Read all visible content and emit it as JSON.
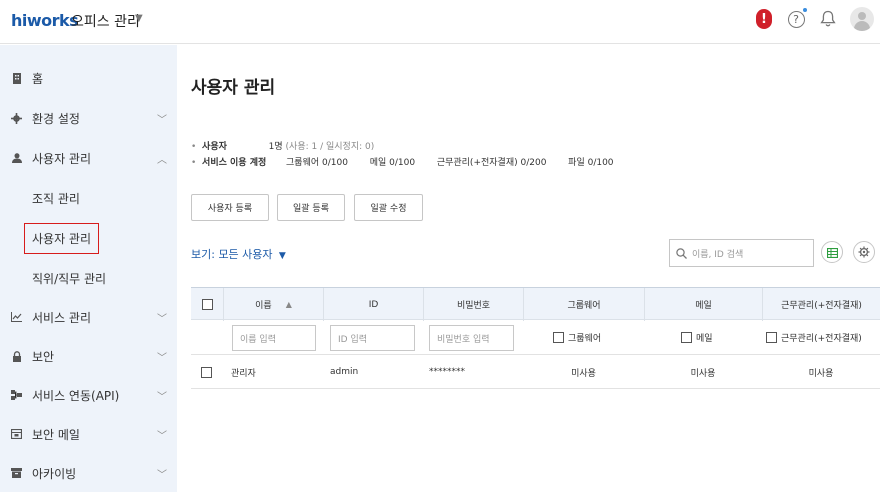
{
  "topbar": {
    "logo": "hiworks",
    "app_title": "오피스 관리",
    "icons": [
      "alert-icon",
      "help-icon",
      "bell-icon",
      "avatar"
    ]
  },
  "sidebar": {
    "items": [
      {
        "label": "홈",
        "icon": "building-icon"
      },
      {
        "label": "환경 설정",
        "icon": "gear-icon"
      },
      {
        "label": "사용자 관리",
        "icon": "person-icon"
      },
      {
        "label": "서비스 관리",
        "icon": "chart-icon"
      },
      {
        "label": "보안",
        "icon": "lock-icon"
      },
      {
        "label": "서비스 연동(API)",
        "icon": "link-icon"
      },
      {
        "label": "보안 메일",
        "icon": "mail-icon"
      },
      {
        "label": "아카이빙",
        "icon": "archive-icon"
      }
    ],
    "subitems": [
      {
        "label": "조직 관리"
      },
      {
        "label": "사용자 관리"
      },
      {
        "label": "직위/직무 관리"
      }
    ]
  },
  "main": {
    "title": "사용자 관리",
    "stats": {
      "users_label": "사용자",
      "users_value": "1명",
      "users_detail": "(사용: 1 / 일시정지: 0)",
      "accounts_label": "서비스 이용 계정",
      "groupware": "그룹웨어  0/100",
      "mail": "메일  0/100",
      "attendance": "근무관리(+전자결재)  0/200",
      "file": "파일  0/100"
    },
    "buttons": {
      "register": "사용자 등록",
      "bulk_register": "일괄 등록",
      "bulk_edit": "일괄 수정"
    },
    "view_filter": "보기: 모든 사용자",
    "search_placeholder": "이름, ID 검색",
    "table": {
      "headers": [
        "이름",
        "ID",
        "비밀번호",
        "그룹웨어",
        "메일",
        "근무관리(+전자결재)"
      ],
      "filter_placeholders": {
        "name": "이름 입력",
        "id": "ID 입력",
        "password": "비밀번호 입력"
      },
      "filter_checks": {
        "groupware": "그룹웨어",
        "mail": "메일",
        "attendance": "근무관리(+전자결재)"
      },
      "rows": [
        {
          "name": "관리자",
          "id": "admin",
          "password": "********",
          "groupware": "미사용",
          "mail": "미사용",
          "attendance": "미사용"
        }
      ]
    }
  },
  "colors": {
    "brand": "#1b5aa8",
    "alert": "#d0202a",
    "active_border": "#d71b1b",
    "sidebar_bg": "#eef3fa"
  }
}
